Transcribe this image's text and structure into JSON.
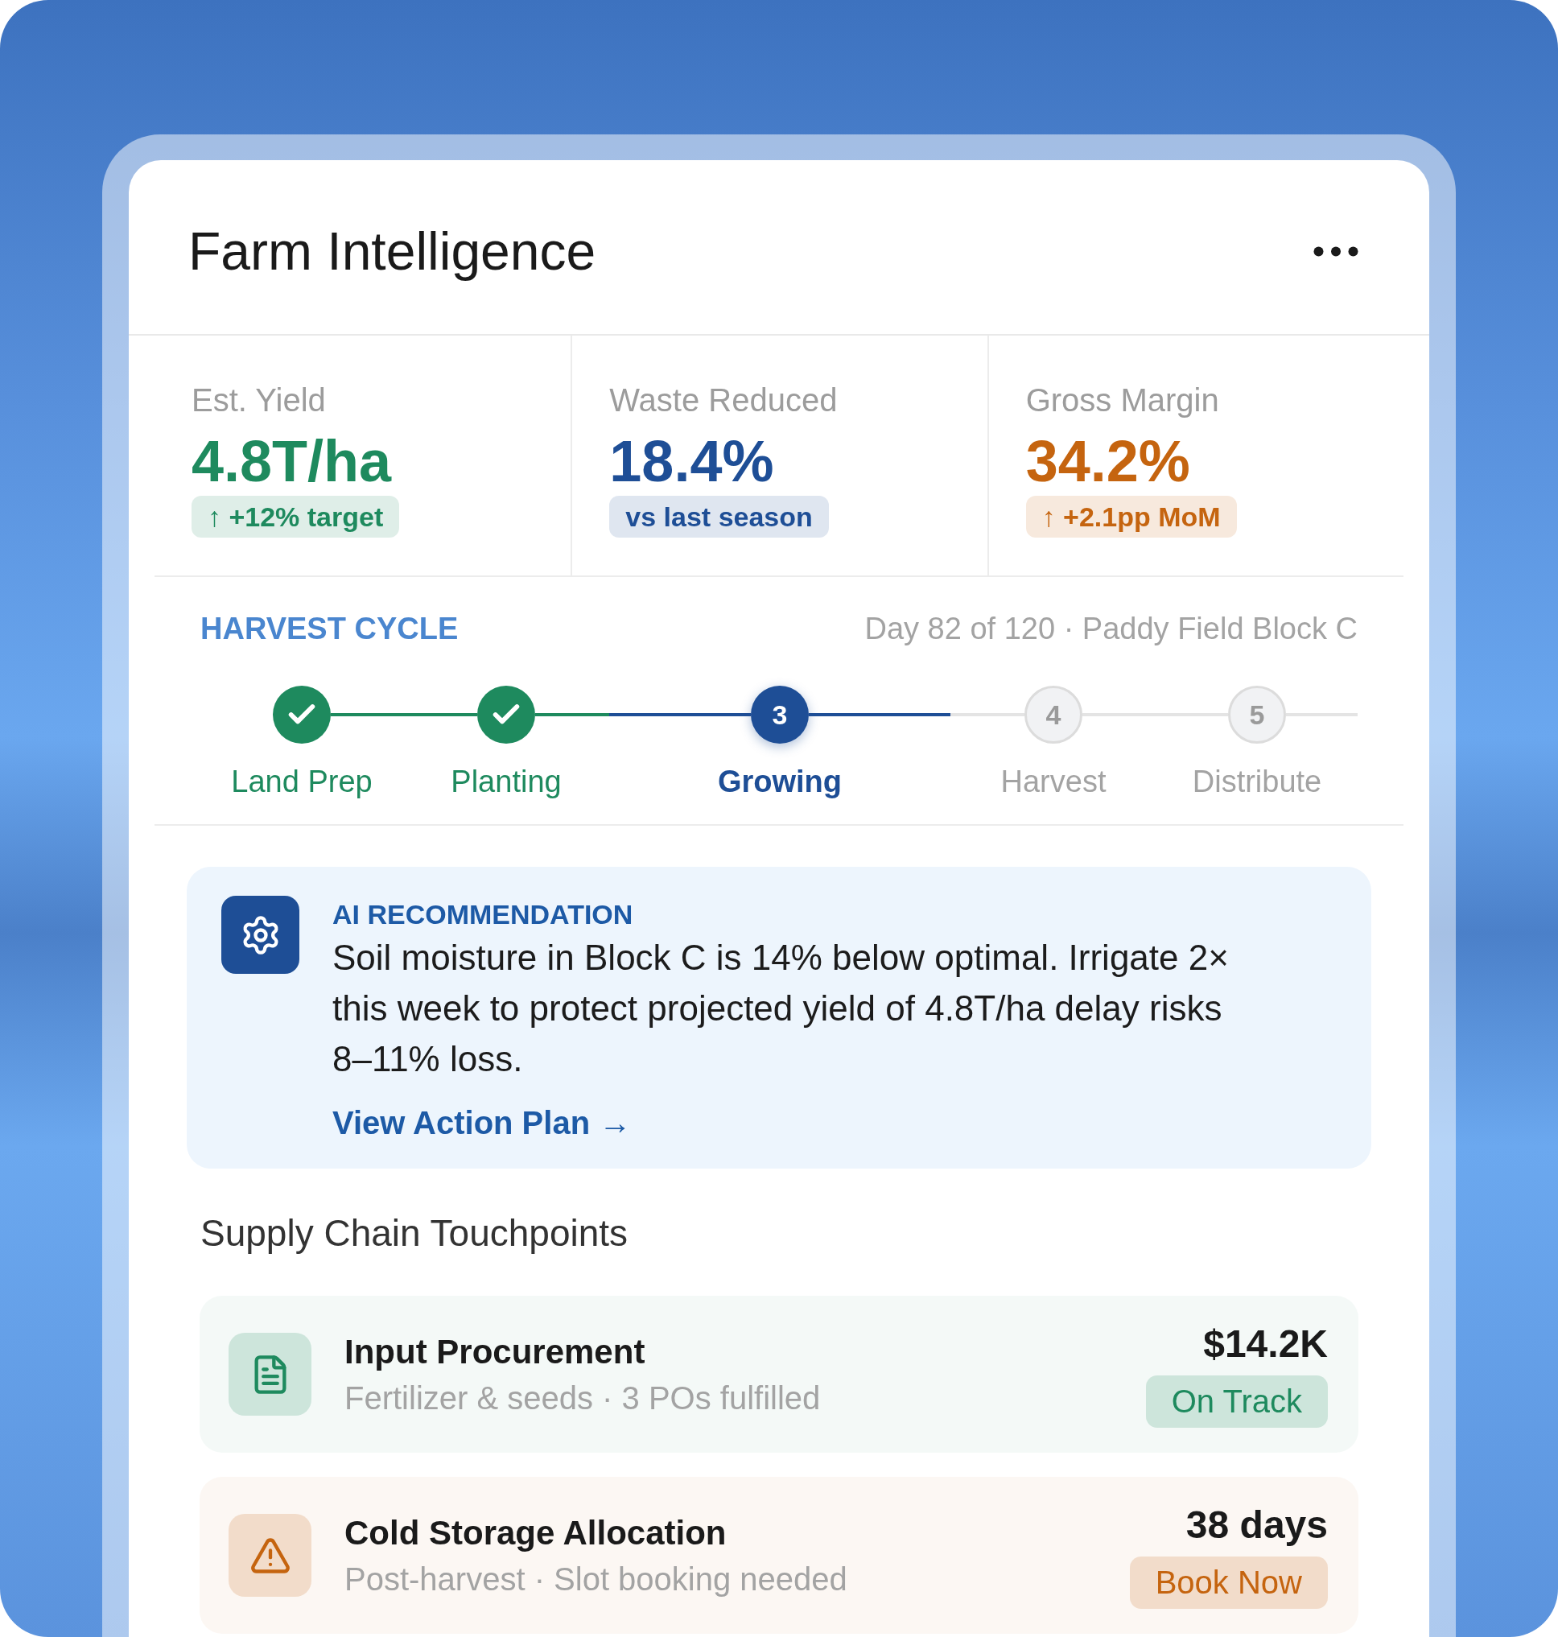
{
  "header": {
    "title": "Farm Intelligence"
  },
  "metrics": [
    {
      "label": "Est. Yield",
      "value": "4.8T/ha",
      "note": "↑ +12% target",
      "color": "#1e8a5e"
    },
    {
      "label": "Waste Reduced",
      "value": "18.4%",
      "note": "vs last season",
      "color": "#1e4e96"
    },
    {
      "label": "Gross Margin",
      "value": "34.2%",
      "note": "↑ +2.1pp MoM",
      "color": "#c5640f"
    }
  ],
  "harvest_cycle": {
    "title": "HARVEST CYCLE",
    "subtitle": "Day 82 of 120 · Paddy Field Block C",
    "steps": [
      {
        "label": "Land Prep",
        "completed": true,
        "active": false
      },
      {
        "label": "Planting",
        "completed": true,
        "active": false
      },
      {
        "label": "Growing",
        "completed": false,
        "active": true,
        "number": "3"
      },
      {
        "label": "Harvest",
        "completed": false,
        "active": false,
        "number": "4"
      },
      {
        "label": "Distribute",
        "completed": false,
        "active": false,
        "number": "5"
      }
    ]
  },
  "recommendation": {
    "label": "AI RECOMMENDATION",
    "text": "Soil moisture in Block C is 14% below optimal. Irrigate 2× this week to protect projected yield of 4.8T/ha delay risks 8–11% loss.",
    "link": "View Action Plan →"
  },
  "supply_chain": {
    "title": "Supply Chain Touchpoints",
    "items": [
      {
        "kind": "ok",
        "title": "Input Procurement",
        "subtitle": "Fertilizer & seeds · 3 POs fulfilled",
        "amount": "$14.2K",
        "action": "On Track",
        "color": "#1e8a5e"
      },
      {
        "kind": "alert",
        "title": "Cold Storage Allocation",
        "subtitle": "Post-harvest · Slot booking needed",
        "amount": "38 days",
        "action": "Book Now",
        "color": "#c5640f"
      }
    ]
  }
}
